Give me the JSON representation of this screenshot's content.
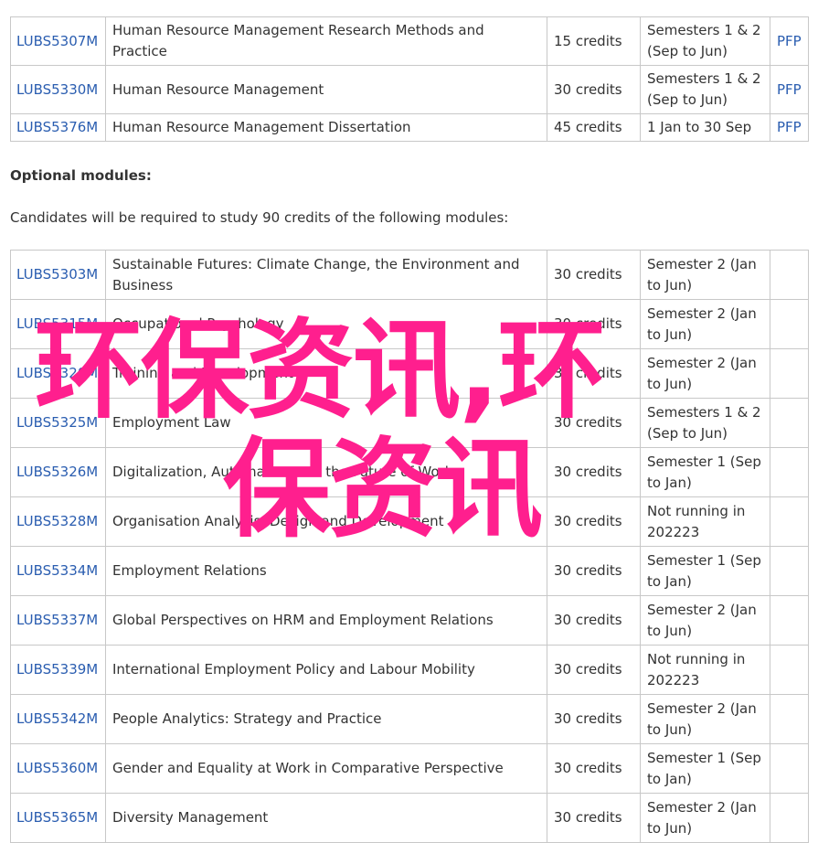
{
  "core_modules": [
    {
      "code": "LUBS5307M",
      "title": "Human Resource Management Research Methods and Practice",
      "credits": "15 credits",
      "semester": "Semesters 1 & 2 (Sep to Jun)",
      "pfp": "PFP"
    },
    {
      "code": "LUBS5330M",
      "title": "Human Resource Management",
      "credits": "30 credits",
      "semester": "Semesters 1 & 2 (Sep to Jun)",
      "pfp": "PFP"
    },
    {
      "code": "LUBS5376M",
      "title": "Human Resource Management Dissertation",
      "credits": "45 credits",
      "semester": "1 Jan to 30 Sep",
      "pfp": "PFP"
    }
  ],
  "optional": {
    "heading": "Optional modules:",
    "intro": "Candidates will be required to study 90 credits of the following modules:"
  },
  "optional_modules": [
    {
      "code": "LUBS5303M",
      "title": "Sustainable Futures: Climate Change, the Environment and Business",
      "credits": "30 credits",
      "semester": "Semester 2 (Jan to Jun)"
    },
    {
      "code": "LUBS5315M",
      "title": "Occupational Psychology",
      "credits": "30 credits",
      "semester": "Semester 2 (Jan to Jun)"
    },
    {
      "code": "LUBS5320M",
      "title": "Training and Development",
      "credits": "30 credits",
      "semester": "Semester 2 (Jan to Jun)"
    },
    {
      "code": "LUBS5325M",
      "title": "Employment Law",
      "credits": "30 credits",
      "semester": "Semesters 1 & 2 (Sep to Jun)"
    },
    {
      "code": "LUBS5326M",
      "title": "Digitalization, Automation and the Future of Work",
      "credits": "30 credits",
      "semester": "Semester 1 (Sep to Jan)"
    },
    {
      "code": "LUBS5328M",
      "title": "Organisation Analysis, Design and Development",
      "credits": "30 credits",
      "semester": "Not running in 202223"
    },
    {
      "code": "LUBS5334M",
      "title": "Employment Relations",
      "credits": "30 credits",
      "semester": "Semester 1 (Sep to Jan)"
    },
    {
      "code": "LUBS5337M",
      "title": "Global Perspectives on HRM and Employment Relations",
      "credits": "30 credits",
      "semester": "Semester 2 (Jan to Jun)"
    },
    {
      "code": "LUBS5339M",
      "title": "International Employment Policy and Labour Mobility",
      "credits": "30 credits",
      "semester": "Not running in 202223"
    },
    {
      "code": "LUBS5342M",
      "title": "People Analytics: Strategy and Practice",
      "credits": "30 credits",
      "semester": "Semester 2 (Jan to Jun)"
    },
    {
      "code": "LUBS5360M",
      "title": "Gender and Equality at Work in Comparative Perspective",
      "credits": "30 credits",
      "semester": "Semester 1 (Sep to Jan)"
    },
    {
      "code": "LUBS5365M",
      "title": "Diversity Management",
      "credits": "30 credits",
      "semester": "Semester 2 (Jan to Jun)"
    }
  ],
  "watermark": {
    "line1": "环保资讯,环",
    "line2": "保资讯"
  }
}
